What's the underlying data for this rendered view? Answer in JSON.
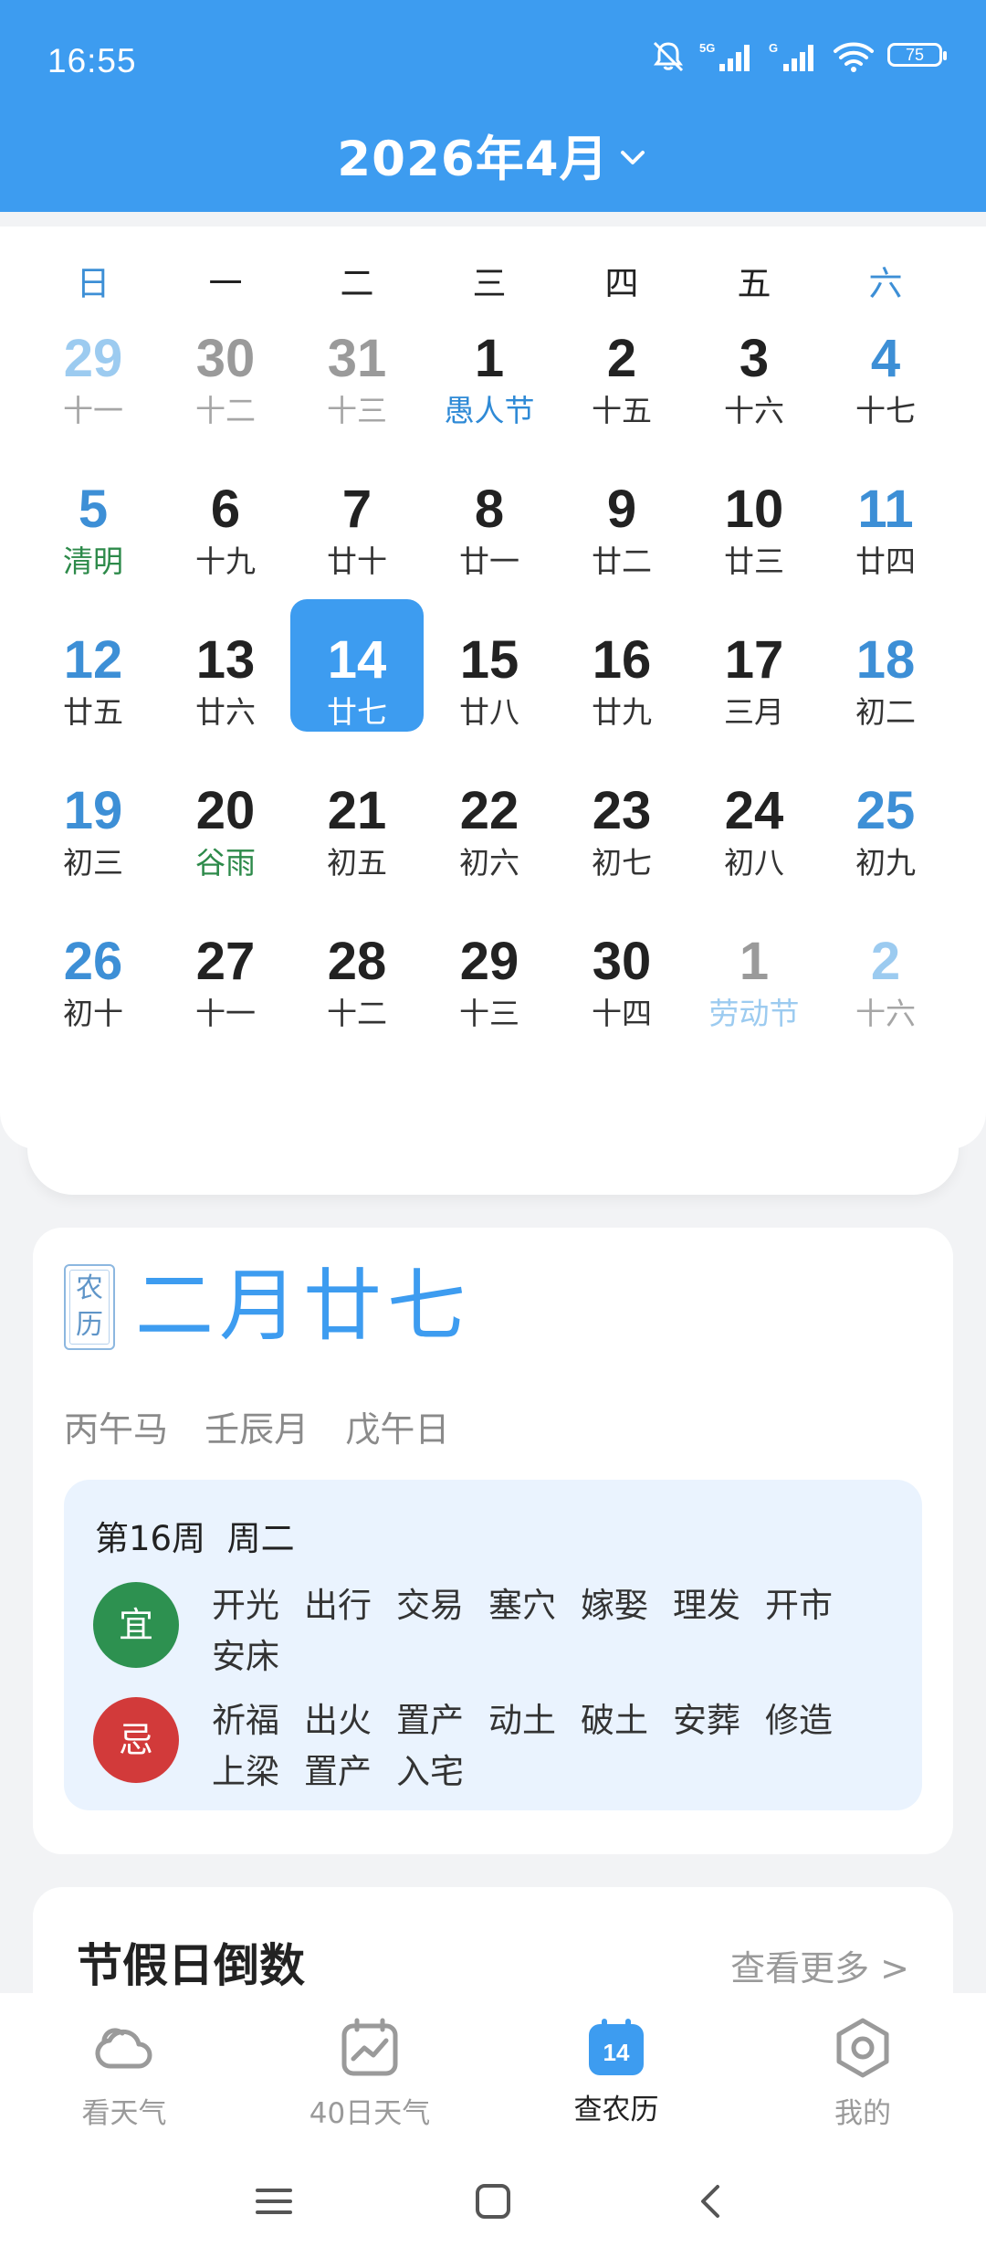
{
  "status_bar": {
    "time": "16:55",
    "battery": "75",
    "network": "5G"
  },
  "header": {
    "title": "2026年4月"
  },
  "weekdays": [
    "日",
    "一",
    "二",
    "三",
    "四",
    "五",
    "六"
  ],
  "calendar": {
    "weeks": [
      [
        {
          "day": "29",
          "sub": "十一",
          "other": true
        },
        {
          "day": "30",
          "sub": "十二",
          "other": true
        },
        {
          "day": "31",
          "sub": "十三",
          "other": true
        },
        {
          "day": "1",
          "sub": "愚人节",
          "festival": true
        },
        {
          "day": "2",
          "sub": "十五"
        },
        {
          "day": "3",
          "sub": "十六"
        },
        {
          "day": "4",
          "sub": "十七"
        }
      ],
      [
        {
          "day": "5",
          "sub": "清明",
          "term": true
        },
        {
          "day": "6",
          "sub": "十九"
        },
        {
          "day": "7",
          "sub": "廿十"
        },
        {
          "day": "8",
          "sub": "廿一"
        },
        {
          "day": "9",
          "sub": "廿二"
        },
        {
          "day": "10",
          "sub": "廿三"
        },
        {
          "day": "11",
          "sub": "廿四"
        }
      ],
      [
        {
          "day": "12",
          "sub": "廿五"
        },
        {
          "day": "13",
          "sub": "廿六"
        },
        {
          "day": "14",
          "sub": "廿七",
          "selected": true
        },
        {
          "day": "15",
          "sub": "廿八"
        },
        {
          "day": "16",
          "sub": "廿九"
        },
        {
          "day": "17",
          "sub": "三月"
        },
        {
          "day": "18",
          "sub": "初二"
        }
      ],
      [
        {
          "day": "19",
          "sub": "初三"
        },
        {
          "day": "20",
          "sub": "谷雨",
          "term": true
        },
        {
          "day": "21",
          "sub": "初五"
        },
        {
          "day": "22",
          "sub": "初六"
        },
        {
          "day": "23",
          "sub": "初七"
        },
        {
          "day": "24",
          "sub": "初八"
        },
        {
          "day": "25",
          "sub": "初九"
        }
      ],
      [
        {
          "day": "26",
          "sub": "初十"
        },
        {
          "day": "27",
          "sub": "十一"
        },
        {
          "day": "28",
          "sub": "十二"
        },
        {
          "day": "29",
          "sub": "十三"
        },
        {
          "day": "30",
          "sub": "十四"
        },
        {
          "day": "1",
          "sub": "劳动节",
          "other": true,
          "festival": true
        },
        {
          "day": "2",
          "sub": "十六",
          "other": true
        }
      ]
    ]
  },
  "lunar": {
    "badge": "农历",
    "date": "二月廿七",
    "ganzhi": "丙午马  壬辰月  戊午日",
    "week_info": "第16周  周二",
    "yi_label": "宜",
    "ji_label": "忌",
    "yi": [
      "开光",
      "出行",
      "交易",
      "塞穴",
      "嫁娶",
      "理发",
      "开市",
      "安床"
    ],
    "ji": [
      "祈福",
      "出火",
      "置产",
      "动土",
      "破土",
      "安葬",
      "修造",
      "上梁",
      "置产",
      "入宅"
    ]
  },
  "holiday": {
    "title": "节假日倒数",
    "more": "查看更多 >"
  },
  "bottom_nav": [
    {
      "label": "看天气",
      "icon": "cloud-icon"
    },
    {
      "label": "40日天气",
      "icon": "chart-calendar-icon"
    },
    {
      "label": "查农历",
      "icon": "calendar-icon",
      "badge": "14",
      "active": true
    },
    {
      "label": "我的",
      "icon": "hexagon-settings-icon"
    }
  ],
  "colors": {
    "accent": "#3d9cf0",
    "yi": "#2d9150",
    "ji": "#d23a3a",
    "weekend": "#3d8fd6"
  }
}
